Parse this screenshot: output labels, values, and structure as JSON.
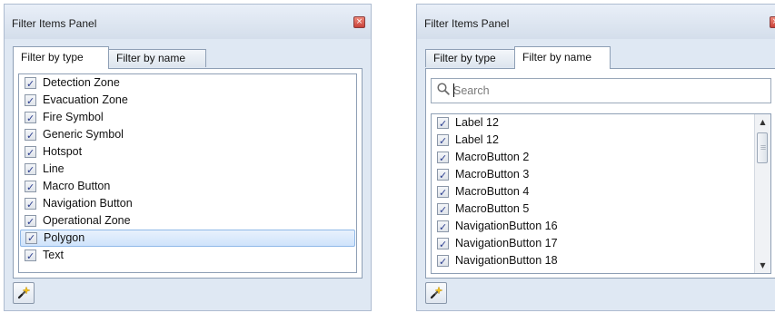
{
  "left_panel": {
    "title": "Filter Items Panel",
    "close_glyph": "×",
    "tabs": [
      {
        "label": "Filter by type",
        "active": true
      },
      {
        "label": "Filter by name",
        "active": false
      }
    ],
    "items": [
      {
        "label": "Detection Zone",
        "checked": true
      },
      {
        "label": "Evacuation Zone",
        "checked": true
      },
      {
        "label": "Fire Symbol",
        "checked": true
      },
      {
        "label": "Generic Symbol",
        "checked": true
      },
      {
        "label": "Hotspot",
        "checked": true
      },
      {
        "label": "Line",
        "checked": true
      },
      {
        "label": "Macro Button",
        "checked": true
      },
      {
        "label": "Navigation Button",
        "checked": true
      },
      {
        "label": "Operational Zone",
        "checked": true
      },
      {
        "label": "Polygon",
        "checked": true,
        "selected": true
      },
      {
        "label": "Text",
        "checked": true
      }
    ],
    "tool_icon": "magic-wand-icon"
  },
  "right_panel": {
    "title": "Filter Items Panel",
    "close_glyph": "×",
    "tabs": [
      {
        "label": "Filter by type",
        "active": false
      },
      {
        "label": "Filter by name",
        "active": true
      }
    ],
    "search": {
      "placeholder": "Search",
      "value": "",
      "icon": "search-icon"
    },
    "items": [
      {
        "label": "Label 12",
        "checked": true
      },
      {
        "label": "Label 12",
        "checked": true
      },
      {
        "label": "MacroButton 2",
        "checked": true
      },
      {
        "label": "MacroButton 3",
        "checked": true
      },
      {
        "label": "MacroButton 4",
        "checked": true
      },
      {
        "label": "MacroButton 5",
        "checked": true
      },
      {
        "label": "NavigationButton 16",
        "checked": true
      },
      {
        "label": "NavigationButton 17",
        "checked": true
      },
      {
        "label": "NavigationButton 18",
        "checked": true
      }
    ],
    "scroll_up_glyph": "▲",
    "scroll_down_glyph": "▼",
    "tool_icon": "magic-wand-icon"
  },
  "colors": {
    "panel_bg": "#dde6f1",
    "selection_border": "#8fb8e8",
    "close_button": "#c8413a"
  }
}
